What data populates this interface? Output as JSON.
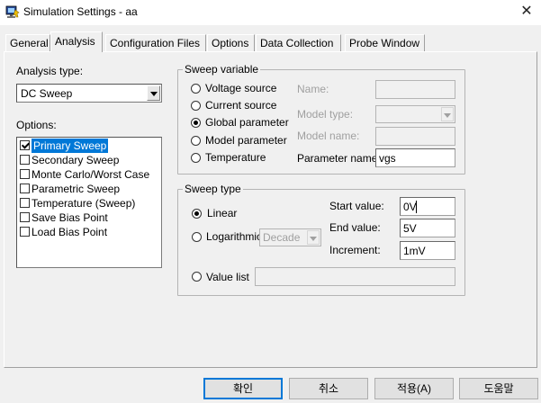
{
  "window": {
    "title": "Simulation Settings - aa",
    "close_glyph": "✕"
  },
  "tabs": [
    {
      "label": "General"
    },
    {
      "label": "Analysis"
    },
    {
      "label": "Configuration Files"
    },
    {
      "label": "Options"
    },
    {
      "label": "Data Collection"
    },
    {
      "label": "Probe Window"
    }
  ],
  "active_tab": "Analysis",
  "analysis_type": {
    "label": "Analysis type:",
    "value": "DC Sweep"
  },
  "options": {
    "label": "Options:",
    "items": [
      {
        "label": "Primary Sweep",
        "checked": true,
        "selected": true
      },
      {
        "label": "Secondary Sweep",
        "checked": false
      },
      {
        "label": "Monte Carlo/Worst Case",
        "checked": false
      },
      {
        "label": "Parametric Sweep",
        "checked": false
      },
      {
        "label": "Temperature (Sweep)",
        "checked": false
      },
      {
        "label": "Save Bias Point",
        "checked": false
      },
      {
        "label": "Load Bias Point",
        "checked": false
      }
    ]
  },
  "sweep_variable": {
    "title": "Sweep variable",
    "radios": [
      {
        "label": "Voltage source",
        "selected": false
      },
      {
        "label": "Current source",
        "selected": false
      },
      {
        "label": "Global parameter",
        "selected": true
      },
      {
        "label": "Model parameter",
        "selected": false
      },
      {
        "label": "Temperature",
        "selected": false
      }
    ],
    "name_label": "Name:",
    "name_value": "",
    "model_type_label": "Model type:",
    "model_type_value": "",
    "model_name_label": "Model name:",
    "model_name_value": "",
    "parameter_name_label": "Parameter name:",
    "parameter_name_value": "vgs"
  },
  "sweep_type": {
    "title": "Sweep type",
    "linear_label": "Linear",
    "logarithmic_label": "Logarithmic",
    "log_scale_value": "Decade",
    "value_list_label": "Value list",
    "value_list_value": "",
    "start_label": "Start value:",
    "start_value": "0V",
    "end_label": "End value:",
    "end_value": "5V",
    "increment_label": "Increment:",
    "increment_value": "1mV",
    "selected": "Linear"
  },
  "buttons": {
    "ok": "확인",
    "cancel": "취소",
    "apply": "적용(A)",
    "help": "도움말"
  }
}
